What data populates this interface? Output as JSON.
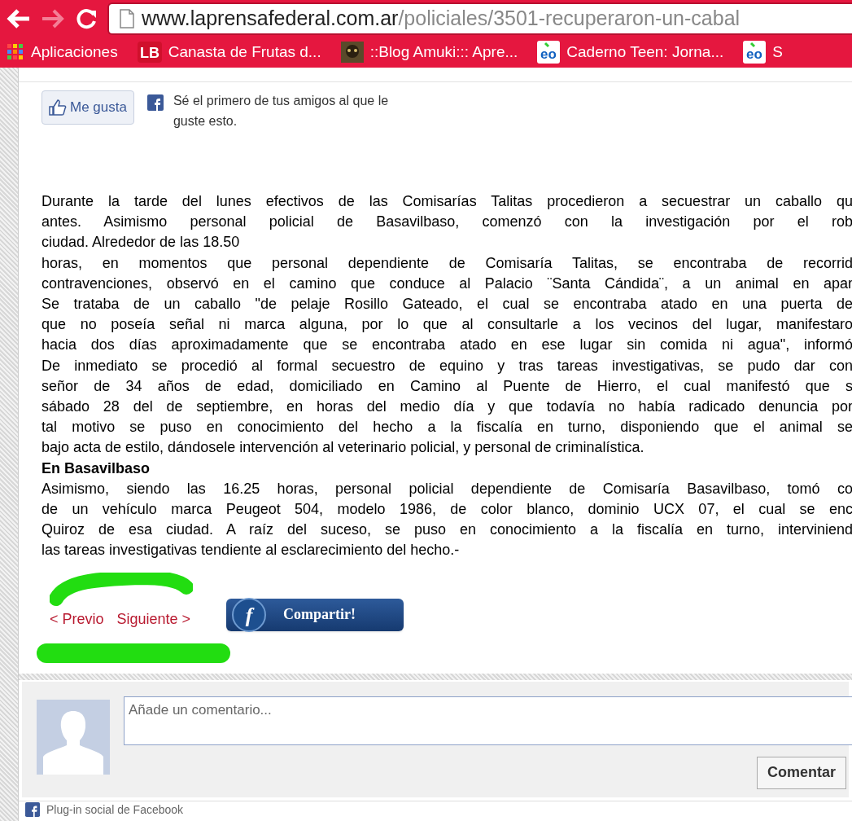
{
  "browser": {
    "address": {
      "host": "www.laprensafederal.com.ar",
      "path": "/policiales/3501-recuperaron-un-cabal"
    },
    "bookmarks": [
      {
        "kind": "apps",
        "label": "Aplicaciones"
      },
      {
        "kind": "lb",
        "icon_text": "LB",
        "label": "Canasta de Frutas d..."
      },
      {
        "kind": "image",
        "label": "::Blog Amuki::: Apre..."
      },
      {
        "kind": "eo",
        "icon_text": "eo",
        "label": "Caderno Teen: Jorna..."
      },
      {
        "kind": "eo",
        "icon_text": "eo",
        "label": "S"
      }
    ]
  },
  "like": {
    "button": "Me gusta",
    "social_text": "Sé el primero de tus amigos al que le guste esto."
  },
  "article": [
    {
      "kind": "cut",
      "text": "Durante la tarde del lunes efectivos de las Comisarías Talitas procedieron a secuestrar un caballo qu"
    },
    {
      "kind": "cut",
      "text": "antes. Asimismo personal policial de Basavilbaso, comenzó con la investigación por el rob"
    },
    {
      "kind": "end",
      "text": "ciudad. Alrededor de las 18.50"
    },
    {
      "kind": "cut",
      "text": "horas, en momentos que personal dependiente de Comisaría Talitas, se encontraba de recorrid"
    },
    {
      "kind": "cut",
      "text": "contravenciones, observó en el camino que conduce al Palacio ¨Santa Cándida¨, a un animal en apar"
    },
    {
      "kind": "cut",
      "text": "Se trataba de un caballo \"de pelaje Rosillo Gateado, el cual se encontraba atado en una puerta de"
    },
    {
      "kind": "cut",
      "text": "que no poseía señal ni marca alguna, por lo que al consultarle a los vecinos del lugar, manifestaro"
    },
    {
      "kind": "cut",
      "text": "hacia dos días aproximadamente que se encontraba atado en ese lugar sin comida ni agua\", informó"
    },
    {
      "kind": "cut",
      "text": "De inmediato se procedió al formal secuestro de equino y tras tareas investigativas, se pudo dar con"
    },
    {
      "kind": "cut",
      "text": "señor de 34 años de edad, domiciliado en Camino al Puente de Hierro, el cual manifestó que s"
    },
    {
      "kind": "cut",
      "text": "sábado 28 del de septiembre, en horas del medio día y que todavía no había radicado denuncia por"
    },
    {
      "kind": "cut",
      "text": "tal motivo se puso en conocimiento del hecho a la fiscalía en turno, disponiendo que el animal se"
    },
    {
      "kind": "end",
      "text": "bajo acta de estilo, dándosele intervención al veterinario policial, y personal de criminalística."
    },
    {
      "kind": "heading",
      "text": "En Basavilbaso"
    },
    {
      "kind": "cut",
      "text": "Asimismo, siendo las 16.25 horas, personal policial dependiente de Comisaría Basavilbaso, tomó co"
    },
    {
      "kind": "cut",
      "text": "de un vehículo marca Peugeot 504, modelo 1986, de color blanco, dominio UCX 07, el cual se enc"
    },
    {
      "kind": "cut",
      "text": "Quiroz de esa ciudad. A raíz del suceso, se puso en conocimiento a la fiscalía en turno, interviniend"
    },
    {
      "kind": "end",
      "text": "las tareas investigativas tendiente al esclarecimiento del hecho.-"
    }
  ],
  "pagination": {
    "previous": "< Previo",
    "next": "Siguiente >",
    "share_icon": "f",
    "share": "Compartir!"
  },
  "comments": {
    "placeholder": "Añade un comentario...",
    "button": "Comentar",
    "footer": "Plug-in social de Facebook"
  }
}
